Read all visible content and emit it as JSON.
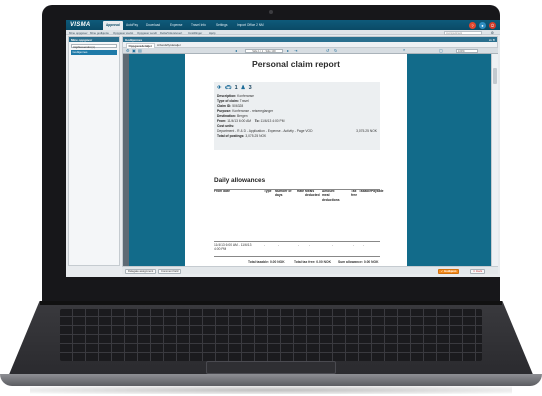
{
  "topnav": {
    "brand": "VISMA",
    "tabs": [
      {
        "label": "Approval",
        "active": true
      },
      {
        "label": "AutoPay"
      },
      {
        "label": "Download"
      },
      {
        "label": "Expense"
      },
      {
        "label": "Travel Info"
      },
      {
        "label": "Settings"
      },
      {
        "label": "Import Office 2 NM"
      }
    ],
    "icons": [
      "help-icon",
      "user-icon",
      "power-icon"
    ]
  },
  "subnav": {
    "items": [
      "Mine oppgaver",
      "Mine godkjente",
      "Oppgaver avvist",
      "Oppgaver sendt",
      "Delta/Viderelevert",
      "Innstillinger",
      "Hjelp"
    ],
    "search_placeholder": "Hurtigsøk/søk"
  },
  "left_panel": {
    "title": "Mine oppgaver",
    "select_value": "Utgiftsoversikt (1)",
    "active_item": "Godkjennes"
  },
  "main": {
    "header": "Godkjennes",
    "tabs": [
      {
        "label": "Oppgavedetaljer",
        "active": true
      },
      {
        "label": "Arbeidsflytdetaljer"
      }
    ],
    "pager": "Side 1 / 1 · Side 100",
    "zoom": "100%"
  },
  "report": {
    "title": "Personal claim report",
    "stats": [
      {
        "icon": "airplane-icon",
        "value": ""
      },
      {
        "icon": "car-icon",
        "value": "1"
      },
      {
        "icon": "person-icon",
        "value": "3"
      }
    ],
    "fields": [
      {
        "label": "Description:",
        "value": "Konferanse"
      },
      {
        "label": "Type of claim:",
        "value": "Travel"
      },
      {
        "label": "Claim ID:",
        "value": "506328"
      },
      {
        "label": "Purpose:",
        "value": "Konferanse - reisereglanger"
      },
      {
        "label": "Destination:",
        "value": "Bergen"
      }
    ],
    "from": {
      "label": "From:",
      "value": "11/4/13 6:00 AM"
    },
    "to": {
      "label": "To:",
      "value": "11/6/13 4:00 PM"
    },
    "cost_units_label": "Cost units:",
    "cost_line": {
      "text": "Department - R & D - Application - Expense - Activity - Page VOD",
      "amount": "3,075.25 NOK"
    },
    "total_postings": {
      "label": "Total of postings:",
      "value": "3,075.25 NOK"
    }
  },
  "allowances": {
    "title": "Daily allowances",
    "headers": [
      "From date",
      "Type",
      "Number of\ndays",
      "Rate",
      "Meals\ndeducted",
      "Amount\nmeal\ndeductions",
      "Tax\nfree",
      "Taxable",
      "Payable"
    ],
    "row": {
      "from": "11/4/13 6:00 AM - 11/6/13 4:00 PM",
      "dashes": [
        "-",
        "-",
        "-",
        "-",
        "-",
        "-",
        "-"
      ]
    },
    "totals": [
      {
        "label": "Total taxable:",
        "value": "0.00 NOK"
      },
      {
        "label": "Total tax free:",
        "value": "0.00 NOK"
      },
      {
        "label": "Sum allowance:",
        "value": "0.00 NOK"
      }
    ]
  },
  "bottom": {
    "left_buttons": [
      "Delegate assignment",
      "Comment field"
    ],
    "approve": "Godkjenn",
    "reject": "Avvis"
  }
}
